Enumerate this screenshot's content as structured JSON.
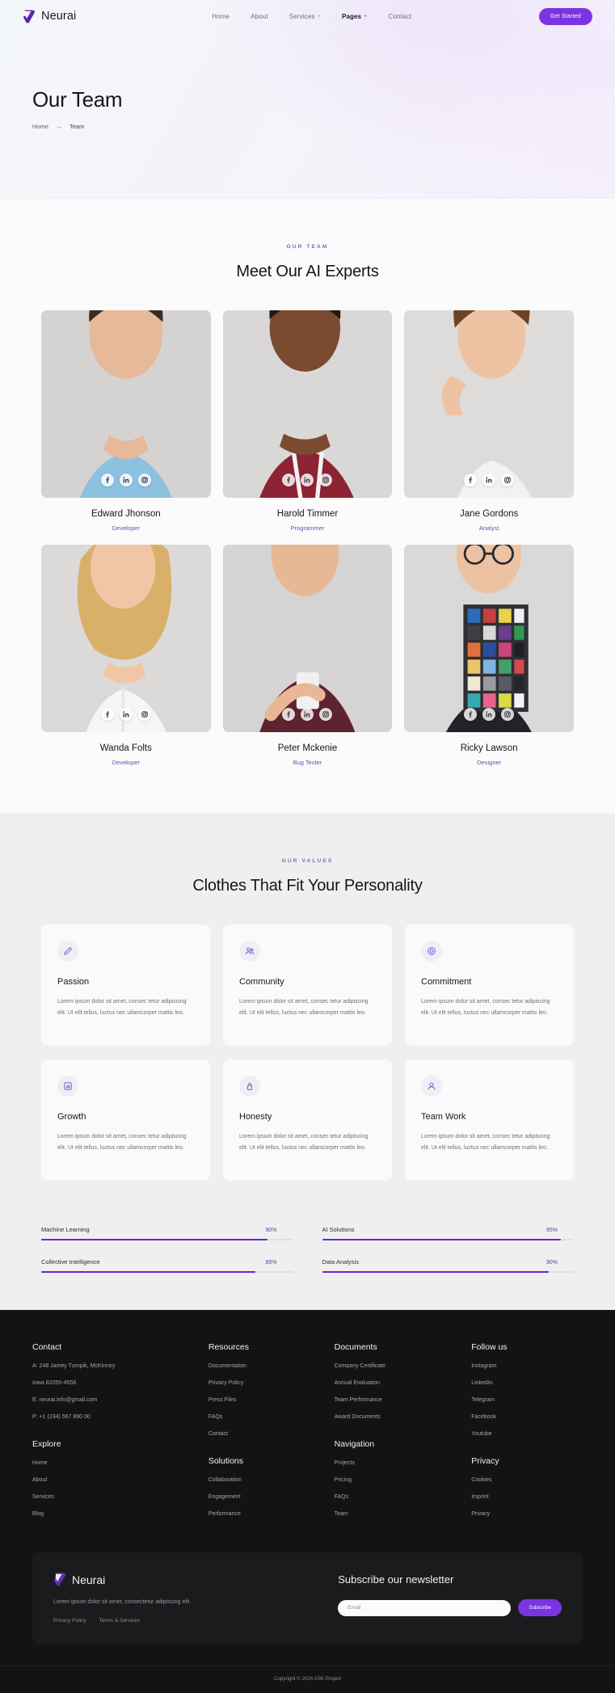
{
  "brand": {
    "name": "Neurai",
    "logo_icon": "neurai-logo-icon"
  },
  "nav": {
    "links": [
      {
        "label": "Home",
        "has_dropdown": false,
        "active": false
      },
      {
        "label": "About",
        "has_dropdown": false,
        "active": false
      },
      {
        "label": "Services",
        "has_dropdown": true,
        "active": false
      },
      {
        "label": "Pages",
        "has_dropdown": true,
        "active": true
      },
      {
        "label": "Contact",
        "has_dropdown": false,
        "active": false
      }
    ],
    "cta_label": "Get Started",
    "cta_color": "#7b35e0"
  },
  "hero": {
    "title": "Our Team",
    "breadcrumb": {
      "home": "Home",
      "separator": "→",
      "current": "Team"
    }
  },
  "team_section": {
    "eyebrow": "OUR TEAM",
    "title": "Meet Our AI Experts",
    "social_icons": [
      "facebook-icon",
      "linkedin-icon",
      "instagram-icon"
    ],
    "members": [
      {
        "name": "Edward Jhonson",
        "role": "Developer"
      },
      {
        "name": "Harold Timmer",
        "role": "Programmer"
      },
      {
        "name": "Jane Gordons",
        "role": "Analyst"
      },
      {
        "name": "Wanda Folts",
        "role": "Developer"
      },
      {
        "name": "Peter Mckenie",
        "role": "Bug Tester"
      },
      {
        "name": "Ricky Lawson",
        "role": "Designer"
      }
    ]
  },
  "values_section": {
    "eyebrow": "OUR VALUES",
    "title": "Clothes That Fit Your Personality",
    "cards": [
      {
        "icon": "pencil-icon",
        "title": "Passion",
        "text": "Lorem ipsum dolor sit amet, consec tetur adipiscing elit. Ut elit tellus, luctus nec ullamcorper mattis leo."
      },
      {
        "icon": "people-group-icon",
        "title": "Community",
        "text": "Lorem ipsum dolor sit amet, consec tetur adipiscing elit. Ut elit tellus, luctus nec ullamcorper mattis leo."
      },
      {
        "icon": "gear-icon",
        "title": "Commitment",
        "text": "Lorem ipsum dolor sit amet, consec tetur adipiscing elit. Ut elit tellus, luctus nec ullamcorper mattis leo."
      },
      {
        "icon": "bar-chart-icon",
        "title": "Growth",
        "text": "Lorem ipsum dolor sit amet, consec tetur adipiscing elit. Ut elit tellus, luctus nec ullamcorper mattis leo."
      },
      {
        "icon": "lock-icon",
        "title": "Honesty",
        "text": "Lorem ipsum dolor sit amet, consec tetur adipiscing elit. Ut elit tellus, luctus nec ullamcorper mattis leo."
      },
      {
        "icon": "user-icon",
        "title": "Team Work",
        "text": "Lorem ipsum dolor sit amet, consec tetur adipiscing elit. Ut elit tellus, luctus nec ullamcorper mattis leo."
      }
    ]
  },
  "skills": {
    "bar_color": "#6a26cf",
    "items": [
      {
        "label": "Machine Learning",
        "value": 90,
        "value_label": "90%"
      },
      {
        "label": "AI Solutions",
        "value": 95,
        "value_label": "95%"
      },
      {
        "label": "Collective Intelligence",
        "value": 85,
        "value_label": "85%"
      },
      {
        "label": "Data Analysis",
        "value": 90,
        "value_label": "90%"
      }
    ]
  },
  "footer": {
    "contact": {
      "title": "Contact",
      "lines": [
        "A: 248 Jamey Turnpik, McKinney",
        "Iowa 82055-4558",
        "E: neurai.info@gmail.com",
        "P: +1 (234) 567 890 00"
      ]
    },
    "explore": {
      "title": "Explore",
      "items": [
        "Home",
        "About",
        "Services",
        "Blog"
      ]
    },
    "resources": {
      "title": "Resources",
      "items": [
        "Documentation",
        "Privacy Policy",
        "Press Files",
        "FAQs",
        "Contact"
      ]
    },
    "solutions": {
      "title": "Solutions",
      "items": [
        "Collaboration",
        "Engagement",
        "Performance"
      ]
    },
    "documents": {
      "title": "Documents",
      "items": [
        "Company Certificate",
        "Annual Evaluation",
        "Team Performance",
        "Award Documents"
      ]
    },
    "navigation": {
      "title": "Navigation",
      "items": [
        "Projects",
        "Pricing",
        "FAQs",
        "Team"
      ]
    },
    "follow": {
      "title": "Follow us",
      "items": [
        "Instagram",
        "LinkedIn",
        "Telegram",
        "Facebook",
        "Youtube"
      ]
    },
    "privacy": {
      "title": "Privacy",
      "items": [
        "Cookies",
        "Imprint",
        "Privacy"
      ]
    },
    "card": {
      "brand": "Neurai",
      "description": "Lorem ipsum dolor sit amet, consectetur adipiscing elit.",
      "links": [
        "Privacy Policy",
        "Terms & Services"
      ],
      "newsletter_title": "Subscribe our newsletter",
      "email_placeholder": "Email",
      "email_value": "",
      "subscribe_label": "Subscribe"
    },
    "copyright": "Copyright © 2024 ASK Project"
  }
}
